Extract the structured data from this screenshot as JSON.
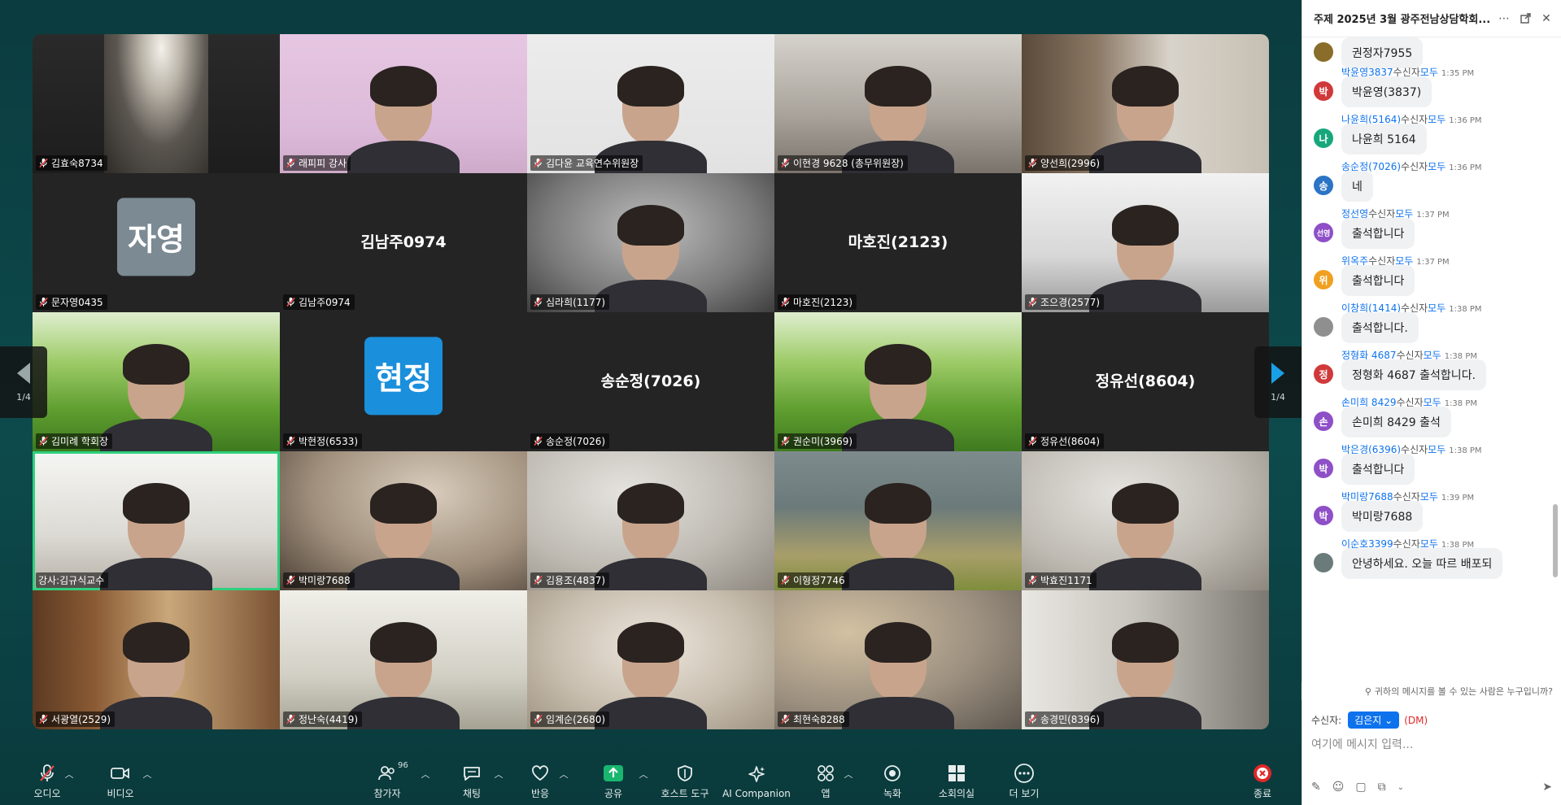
{
  "tiles": [
    {
      "name": "김효숙8734",
      "bg": "a"
    },
    {
      "name": "래피피 강사",
      "bg": "pink"
    },
    {
      "name": "김다윤 교육연수위원장",
      "bg": "office"
    },
    {
      "name": "이현경 9628 (총무위원장)",
      "bg": "room"
    },
    {
      "name": "양선희(2996)",
      "bg": "shelf"
    },
    {
      "name": "문자영0435",
      "bg": "dark",
      "avatar_text": "자영",
      "avatar_color": "#7b8a93"
    },
    {
      "name": "김남주0974",
      "bg": "dark",
      "big_name": "김남주0974"
    },
    {
      "name": "심라희(1177)",
      "bg": "blur-grey"
    },
    {
      "name": "마호진(2123)",
      "bg": "dark",
      "big_name": "마호진(2123)"
    },
    {
      "name": "조으경(2577)",
      "bg": "ceiling"
    },
    {
      "name": "김미례 학회장",
      "bg": "grass"
    },
    {
      "name": "박현정(6533)",
      "bg": "dark",
      "avatar_text": "현정",
      "avatar_color": "#1a8fdc"
    },
    {
      "name": "송순정(7026)",
      "bg": "dark",
      "big_name": "송순정(7026)"
    },
    {
      "name": "권순미(3969)",
      "bg": "grass"
    },
    {
      "name": "정유선(8604)",
      "bg": "dark",
      "big_name": "정유선(8604)"
    },
    {
      "name": "강사:김규식교수",
      "bg": "window",
      "active": true,
      "muted": false
    },
    {
      "name": "박미랑7688",
      "bg": "blur-warm"
    },
    {
      "name": "김용조(4837)",
      "bg": "blur-light"
    },
    {
      "name": "이형정7746",
      "bg": "lake"
    },
    {
      "name": "박효진1171",
      "bg": "blur-light"
    },
    {
      "name": "서광열(2529)",
      "bg": "library"
    },
    {
      "name": "정난숙(4419)",
      "bg": "stripe"
    },
    {
      "name": "임계순(2680)",
      "bg": "blur-beige"
    },
    {
      "name": "최현숙8288",
      "bg": "blur-mixed"
    },
    {
      "name": "송경민(8396)",
      "bg": "closet"
    }
  ],
  "pager": {
    "left": "1/4",
    "right": "1/4"
  },
  "toolbar": {
    "audio": "오디오",
    "video": "비디오",
    "participants": "참가자",
    "participants_count": "96",
    "chat": "채팅",
    "react": "반응",
    "share": "공유",
    "host_tools": "호스트 도구",
    "ai_companion": "AI Companion",
    "apps": "앱",
    "record": "녹화",
    "breakout": "소회의실",
    "more": "더 보기",
    "end": "종료"
  },
  "chat": {
    "title": "주제 2025년 3월 광주전남상담학회...",
    "to_word": "수신자",
    "all_word": "모두",
    "messages": [
      {
        "sender": "",
        "time": "",
        "text": "권정자7955",
        "avatar": "",
        "avatar_color": "#8a6d2a"
      },
      {
        "sender": "박윤영3837",
        "time": "1:35 PM",
        "text": "박윤영(3837)",
        "avatar": "박",
        "avatar_color": "#d0393a"
      },
      {
        "sender": "나윤희(5164)",
        "time": "1:36 PM",
        "text": "나윤희 5164",
        "avatar": "나",
        "avatar_color": "#17a77a"
      },
      {
        "sender": "송순정(7026)",
        "time": "1:36 PM",
        "text": "네",
        "avatar": "송",
        "avatar_color": "#2b73c5"
      },
      {
        "sender": "정선영",
        "time": "1:37 PM",
        "text": "출석합니다",
        "avatar": "선영",
        "avatar_color": "#8e4fc7"
      },
      {
        "sender": "위옥주",
        "time": "1:37 PM",
        "text": "출석합니다",
        "avatar": "위",
        "avatar_color": "#f0a020"
      },
      {
        "sender": "이창희(1414)",
        "time": "1:38 PM",
        "text": "출석합니다.",
        "avatar": "",
        "avatar_color": "#8f8f8f"
      },
      {
        "sender": "정형화 4687",
        "time": "1:38 PM",
        "text": "정형화 4687 출석합니다.",
        "avatar": "정",
        "avatar_color": "#d0393a"
      },
      {
        "sender": "손미희 8429",
        "time": "1:38 PM",
        "text": "손미희 8429 출석",
        "avatar": "손",
        "avatar_color": "#8e4fc7"
      },
      {
        "sender": "박은경(6396)",
        "time": "1:38 PM",
        "text": "출석합니다",
        "avatar": "박",
        "avatar_color": "#8e4fc7"
      },
      {
        "sender": "박미랑7688",
        "time": "1:39 PM",
        "text": "박미랑7688",
        "avatar": "박",
        "avatar_color": "#8e4fc7"
      },
      {
        "sender": "이순호3399",
        "time": "1:38 PM",
        "text": "안녕하세요. 오늘 따르 배포되",
        "avatar": "",
        "avatar_color": "#6b7a7a"
      }
    ],
    "privacy_text": "귀하의 메시지를 볼 수 있는 사람은 누구입니까?",
    "recipient_label": "수신자:",
    "recipient_value": "김은지",
    "dm_tag": "(DM)",
    "input_placeholder": "여기에 메시지 입력..."
  }
}
